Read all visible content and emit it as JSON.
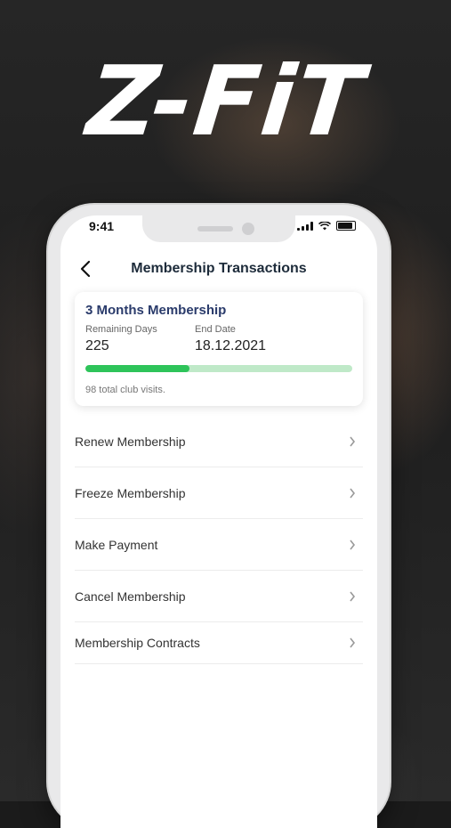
{
  "brand": {
    "logo_text": "Z-FiT"
  },
  "status_bar": {
    "time": "9:41"
  },
  "header": {
    "title": "Membership Transactions",
    "back_icon": "chevron-left-icon"
  },
  "membership_card": {
    "title": "3 Months Membership",
    "remaining_days_label": "Remaining Days",
    "remaining_days_value": "225",
    "end_date_label": "End Date",
    "end_date_value": "18.12.2021",
    "progress_fraction": 0.39,
    "visits_text": "98 total club visits.",
    "colors": {
      "progress_fill": "#2ec45a",
      "progress_track": "#bfe9c8",
      "title": "#2a3b6b"
    }
  },
  "menu": {
    "items": [
      {
        "label": "Renew Membership"
      },
      {
        "label": "Freeze Membership"
      },
      {
        "label": "Make Payment"
      },
      {
        "label": "Cancel Membership"
      },
      {
        "label": "Membership Contracts"
      }
    ]
  }
}
